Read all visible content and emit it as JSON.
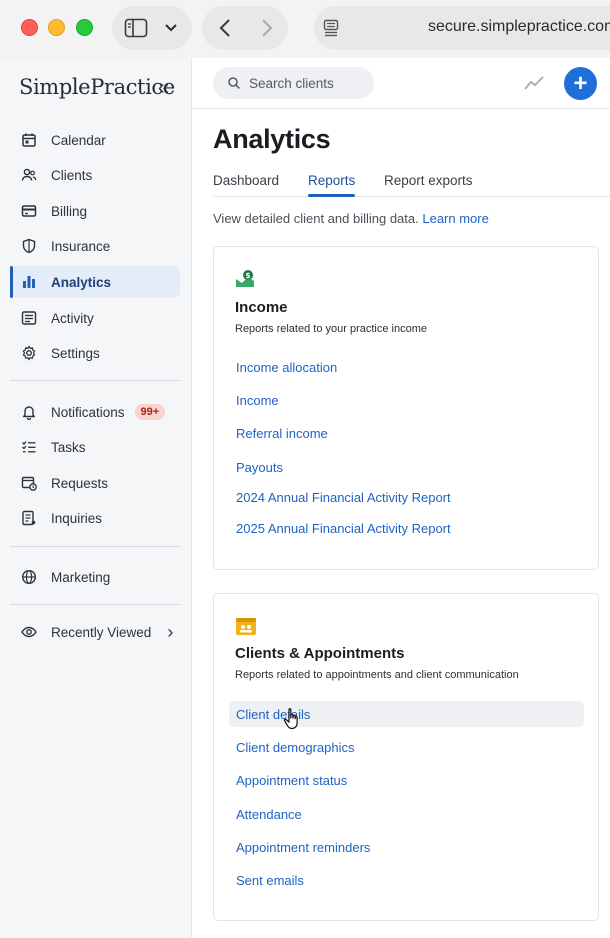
{
  "browser": {
    "url": "secure.simplepractice.com"
  },
  "sidebar": {
    "brand": "SimplePractice",
    "collapse_icon": "double-chevron-left-icon",
    "items": [
      {
        "label": "Calendar",
        "icon": "calendar-icon"
      },
      {
        "label": "Clients",
        "icon": "users-icon"
      },
      {
        "label": "Billing",
        "icon": "credit-card-icon"
      },
      {
        "label": "Insurance",
        "icon": "shield-icon"
      },
      {
        "label": "Analytics",
        "icon": "bar-chart-icon",
        "active": true
      },
      {
        "label": "Activity",
        "icon": "list-icon"
      },
      {
        "label": "Settings",
        "icon": "gear-icon"
      },
      {
        "label": "Notifications",
        "icon": "bell-icon",
        "badge": "99+"
      },
      {
        "label": "Tasks",
        "icon": "checklist-icon"
      },
      {
        "label": "Requests",
        "icon": "calendar-clock-icon"
      },
      {
        "label": "Inquiries",
        "icon": "inbox-icon"
      },
      {
        "label": "Marketing",
        "icon": "globe-icon"
      },
      {
        "label": "Recently Viewed",
        "icon": "eye-icon"
      }
    ]
  },
  "topbar": {
    "search_placeholder": "Search clients"
  },
  "page": {
    "title": "Analytics",
    "tabs": [
      {
        "label": "Dashboard"
      },
      {
        "label": "Reports",
        "active": true
      },
      {
        "label": "Report exports"
      }
    ],
    "intro_text": "View detailed client and billing data.",
    "learn_more": "Learn more"
  },
  "cards": [
    {
      "title": "Income",
      "description": "Reports related to your practice income",
      "links": [
        "Income allocation",
        "Income",
        "Referral income",
        "Payouts",
        "2024 Annual Financial Activity Report",
        "2025 Annual Financial Activity Report"
      ]
    },
    {
      "title": "Clients & Appointments",
      "description": "Reports related to appointments and client communication",
      "links": [
        "Client details",
        "Client demographics",
        "Appointment status",
        "Attendance",
        "Appointment reminders",
        "Sent emails"
      ]
    }
  ],
  "colors": {
    "accent": "#1f5fb8",
    "link": "#1f63c4",
    "badge_bg": "#f8d3cf",
    "badge_text": "#b42318",
    "active_nav_bg": "#e3ecf8"
  }
}
